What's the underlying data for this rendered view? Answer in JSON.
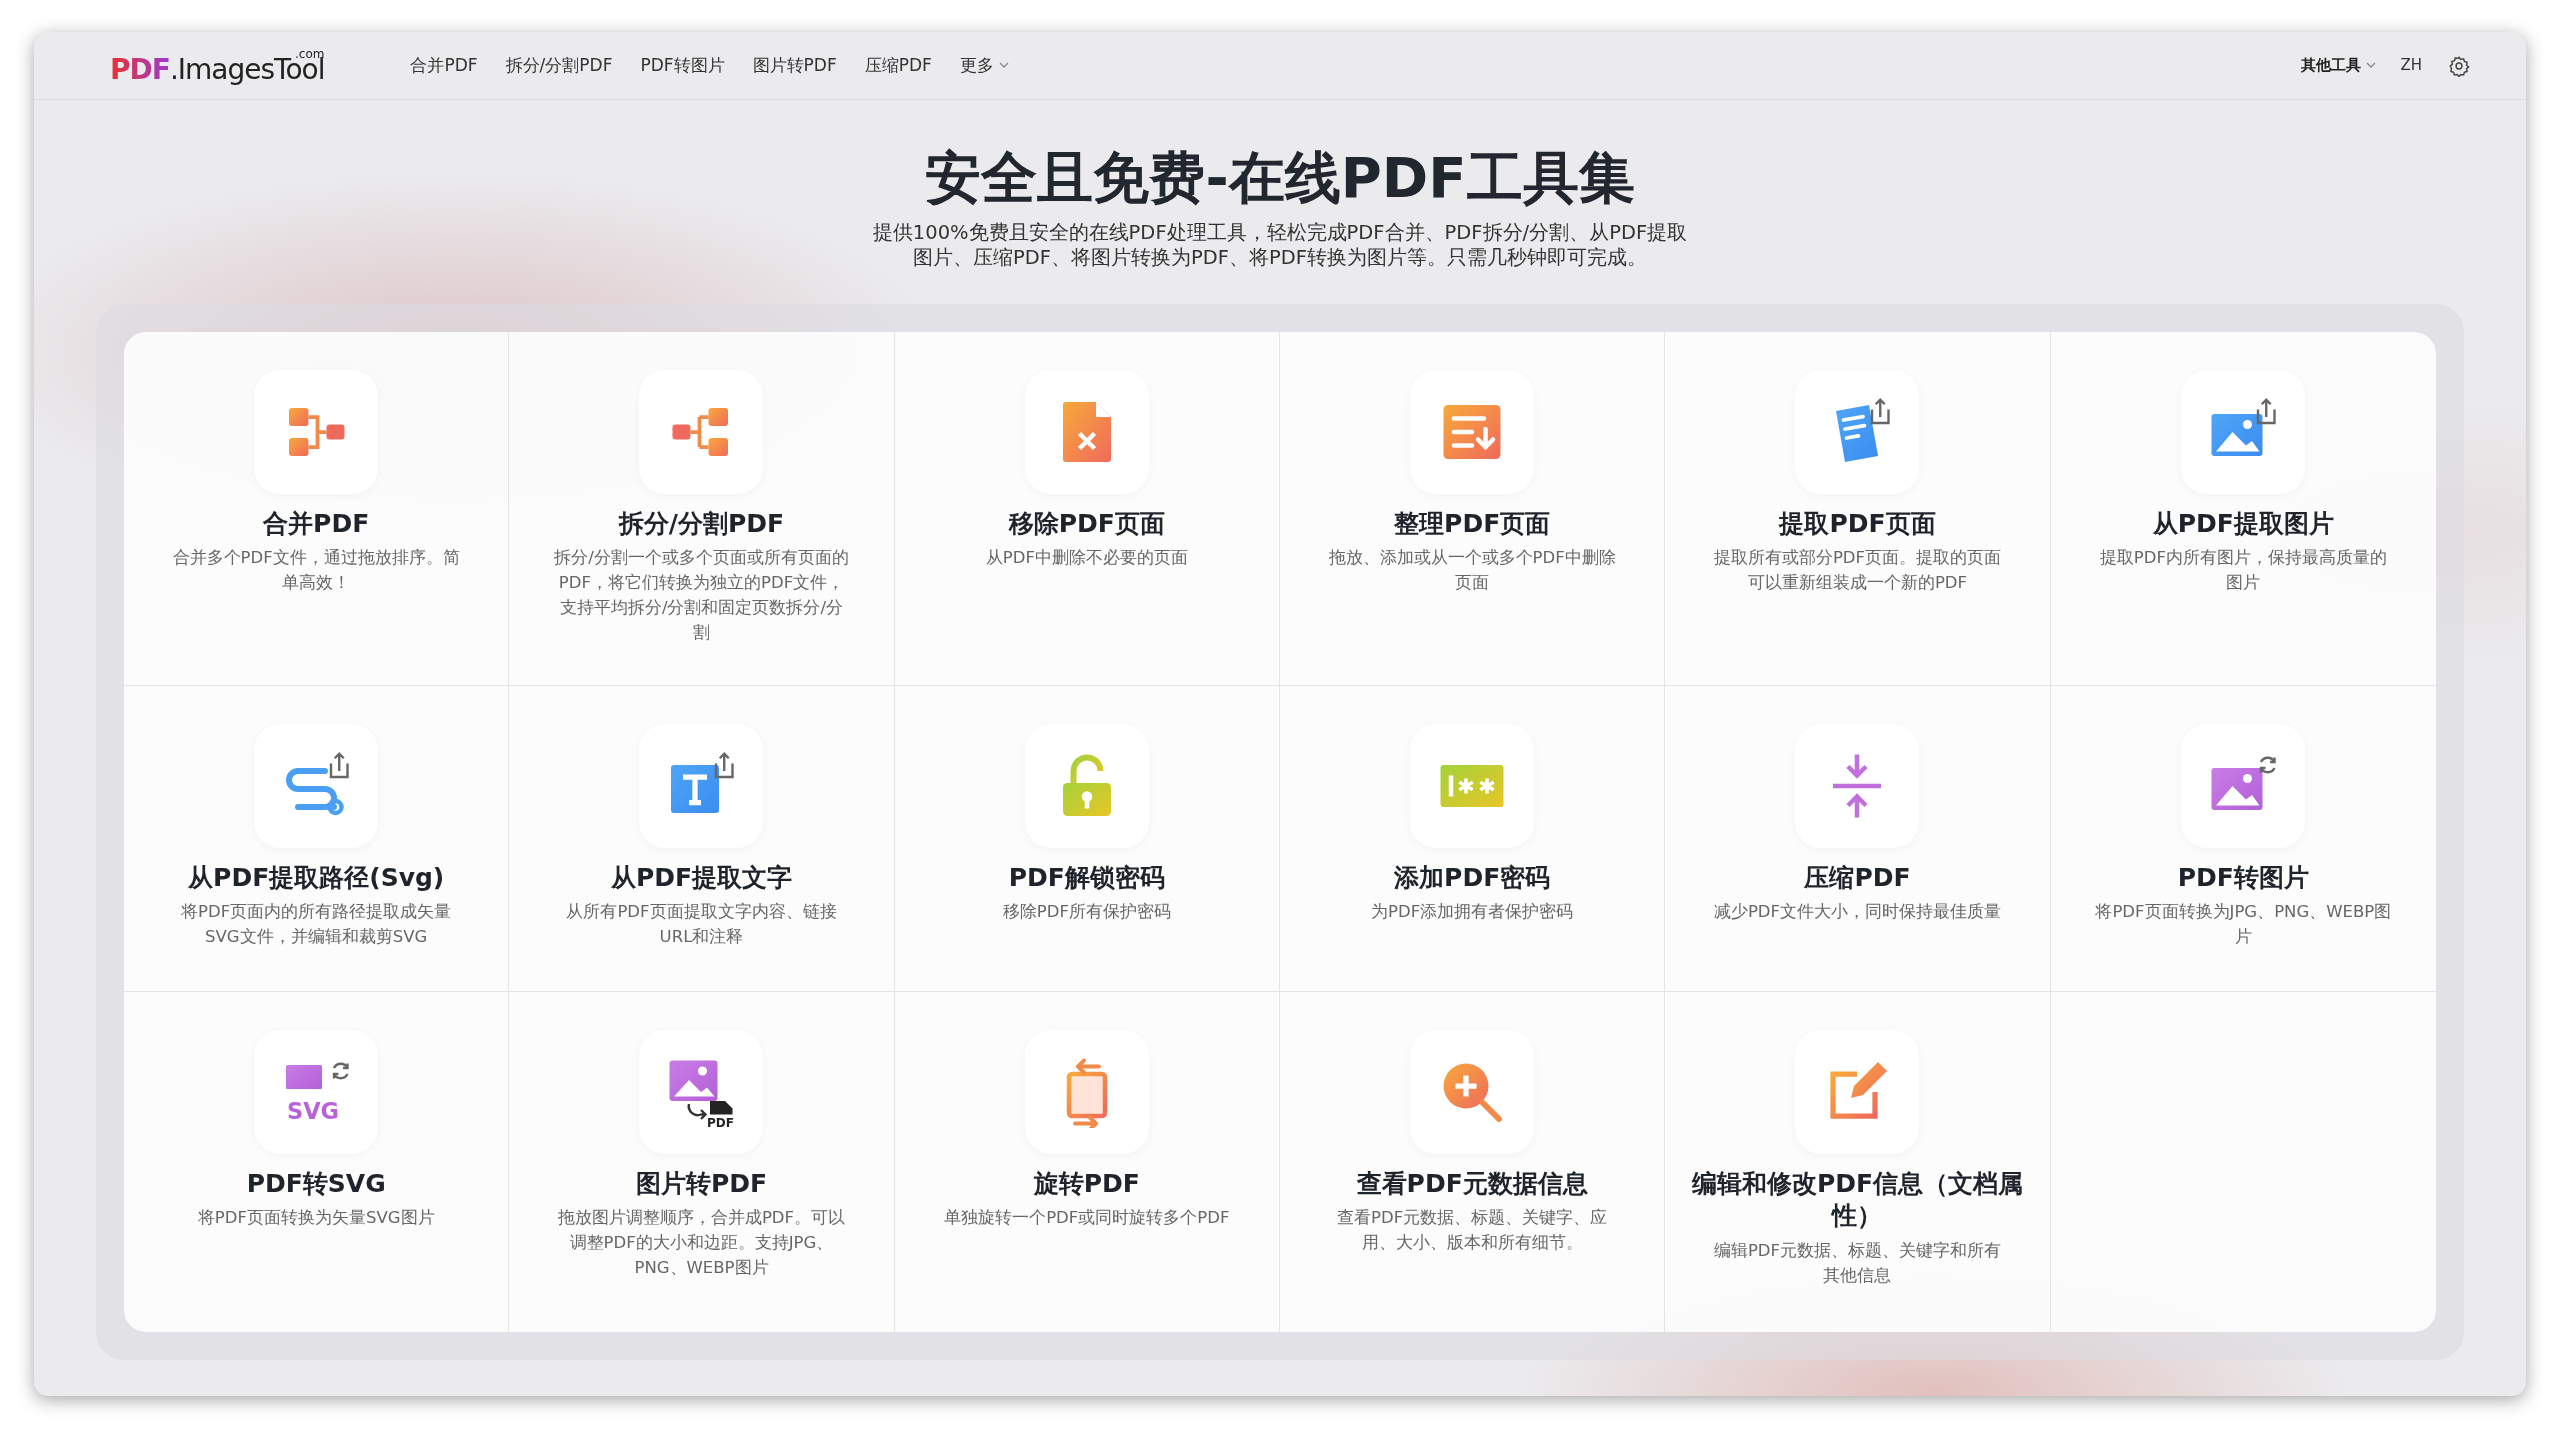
{
  "logo": {
    "brand": "PDF",
    "name": ".ImagesTool",
    "suffix": ".com"
  },
  "nav": [
    {
      "label": "合并PDF",
      "kind": "link"
    },
    {
      "label": "拆分/分割PDF",
      "kind": "link"
    },
    {
      "label": "PDF转图片",
      "kind": "link"
    },
    {
      "label": "图片转PDF",
      "kind": "link"
    },
    {
      "label": "压缩PDF",
      "kind": "link"
    },
    {
      "label": "更多",
      "kind": "dropdown"
    }
  ],
  "nav_right": {
    "tools": "其他工具",
    "language": "ZH"
  },
  "hero": {
    "title": "安全且免费-在线PDF工具集",
    "subtitle_lines": [
      "提供100%免费且安全的在线PDF处理工具，轻松完成PDF合并、PDF拆分/分割、从PDF提取",
      "图片、压缩PDF、将图片转换为PDF、将PDF转换为图片等。只需几秒钟即可完成。"
    ]
  },
  "tools": [
    {
      "kind": "merge",
      "title": "合并PDF",
      "description": "合并多个PDF文件，通过拖放排序。简单高效！"
    },
    {
      "kind": "split",
      "title": "拆分/分割PDF",
      "description": "拆分/分割一个或多个页面或所有页面的PDF，将它们转换为独立的PDF文件，支持平均拆分/分割和固定页数拆分/分割"
    },
    {
      "kind": "remove",
      "title": "移除PDF页面",
      "description": "从PDF中删除不必要的页面"
    },
    {
      "kind": "organize",
      "title": "整理PDF页面",
      "description": "拖放、添加或从一个或多个PDF中删除页面"
    },
    {
      "kind": "extract-pages",
      "title": "提取PDF页面",
      "description": "提取所有或部分PDF页面。提取的页面可以重新组装成一个新的PDF"
    },
    {
      "kind": "extract-images",
      "title": "从PDF提取图片",
      "description": "提取PDF内所有图片，保持最高质量的图片"
    },
    {
      "kind": "extract-path",
      "title": "从PDF提取路径(Svg)",
      "description": "将PDF页面内的所有路径提取成矢量SVG文件，并编辑和裁剪SVG"
    },
    {
      "kind": "extract-text",
      "title": "从PDF提取文字",
      "description": "从所有PDF页面提取文字内容、链接URL和注释"
    },
    {
      "kind": "unlock",
      "title": "PDF解锁密码",
      "description": "移除PDF所有保护密码"
    },
    {
      "kind": "protect",
      "title": "添加PDF密码",
      "description": "为PDF添加拥有者保护密码"
    },
    {
      "kind": "compress",
      "title": "压缩PDF",
      "description": "减少PDF文件大小，同时保持最佳质量"
    },
    {
      "kind": "to-image",
      "title": "PDF转图片",
      "description": "将PDF页面转换为JPG、PNG、WEBP图片"
    },
    {
      "kind": "to-svg",
      "icon_text": "SVG",
      "title": "PDF转SVG",
      "description": "将PDF页面转换为矢量SVG图片"
    },
    {
      "kind": "to-pdf",
      "icon_text": "PDF",
      "title": "图片转PDF",
      "description": "拖放图片调整顺序，合并成PDF。可以调整PDF的大小和边距。支持JPG、PNG、WEBP图片"
    },
    {
      "kind": "rotate",
      "title": "旋转PDF",
      "description": "单独旋转一个PDF或同时旋转多个PDF"
    },
    {
      "kind": "metadata",
      "title": "查看PDF元数据信息",
      "description": "查看PDF元数据、标题、关键字、应用、大小、版本和所有细节。"
    },
    {
      "kind": "edit",
      "title": "编辑和修改PDF信息（文档属性）",
      "description": "编辑PDF元数据、标题、关键字和所有其他信息"
    }
  ]
}
